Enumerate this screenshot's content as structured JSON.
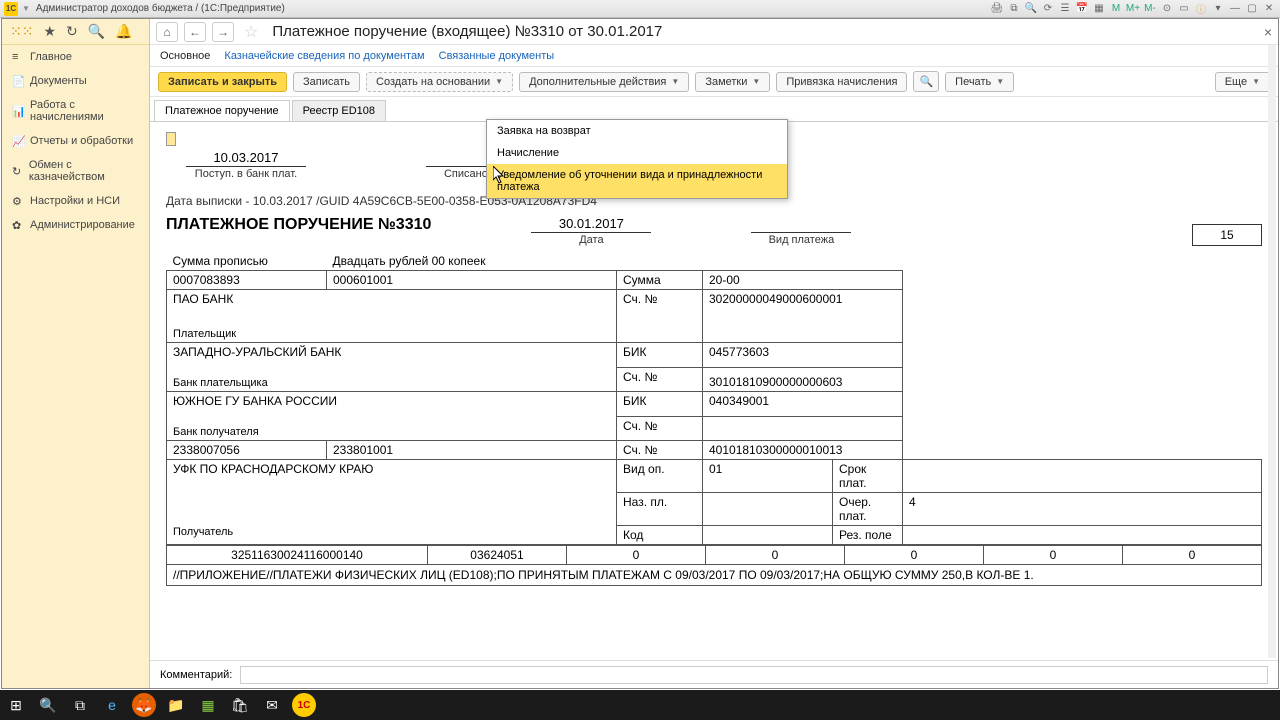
{
  "titlebar": {
    "app": "1C",
    "path": "Администратор доходов бюджета /  (1С:Предприятие)"
  },
  "sidebar": {
    "items": [
      {
        "icon": "≡",
        "label": "Главное"
      },
      {
        "icon": "📄",
        "label": "Документы"
      },
      {
        "icon": "📊",
        "label": "Работа с начислениями"
      },
      {
        "icon": "📈",
        "label": "Отчеты и обработки"
      },
      {
        "icon": "↻",
        "label": "Обмен с казначейством"
      },
      {
        "icon": "⚙",
        "label": "Настройки и НСИ"
      },
      {
        "icon": "✿",
        "label": "Администрирование"
      }
    ]
  },
  "nav": {
    "title": "Платежное поручение (входящее) №3310 от 30.01.2017"
  },
  "linktabs": {
    "t0": "Основное",
    "t1": "Казначейские сведения по документам",
    "t2": "Связанные документы"
  },
  "buttons": {
    "save_close": "Записать и закрыть",
    "save": "Записать",
    "create_based": "Создать на основании",
    "add_actions": "Дополнительные действия",
    "notes": "Заметки",
    "bind": "Привязка начисления",
    "print": "Печать",
    "more": "Еще"
  },
  "tabs": {
    "t0": "Платежное поручение",
    "t1": "Реестр ED108"
  },
  "dropdown": {
    "i0": "Заявка на возврат",
    "i1": "Начисление",
    "i2": "Уведомление об уточнении вида и принадлежности платежа"
  },
  "top_fields": {
    "date1": "10.03.2017",
    "date1_label": "Поступ. в банк плат.",
    "date2_label": "Списано со сч. плат."
  },
  "guid": "Дата выписки - 10.03.2017 /GUID 4A59C6CB-5E00-0358-E053-0A1208A73FD4",
  "header2": {
    "title": "ПЛАТЕЖНОЕ ПОРУЧЕНИЕ №3310",
    "date": "30.01.2017",
    "date_label": "Дата",
    "paytype_label": "Вид платежа",
    "num_box": "15"
  },
  "labels": {
    "sum_words": "Сумма прописью",
    "sum_words_val": "Двадцать рублей 00 копеек",
    "sum": "Сумма",
    "sum_val": "20-00",
    "inn1": "0007083893",
    "kpp1": "000601001",
    "payer_name": "ПАО БАНК",
    "acc_no": "Сч. №",
    "acc1": "30200000049000600001",
    "payer_label": "Плательщик",
    "payer_bank": "ЗАПАДНО-УРАЛЬСКИЙ БАНК",
    "bik": "БИК",
    "bik1": "045773603",
    "acc2": "30101810900000000603",
    "payer_bank_label": "Банк плательщика",
    "recv_bank": "ЮЖНОЕ ГУ БАНКА РОССИИ",
    "bik2": "040349001",
    "recv_bank_label": "Банк получателя",
    "inn2": "2338007056",
    "kpp2": "233801001",
    "acc3": "40101810300000010013",
    "receiver": "УФК ПО КРАСНОДАРСКОМУ КРАЮ",
    "receiver_label": "Получатель",
    "vid_op": "Вид оп.",
    "vid_op_val": "01",
    "srok": "Срок плат.",
    "naz_pl": "Наз. пл.",
    "ocher": "Очер. плат.",
    "ocher_val": "4",
    "kod": "Код",
    "rez": "Рез. поле"
  },
  "codes": {
    "c0": "32511630024116000140",
    "c1": "03624051",
    "c2": "0",
    "c3": "0",
    "c4": "0",
    "c5": "0",
    "c6": "0"
  },
  "purpose": "//ПРИЛОЖЕНИЕ//ПЛАТЕЖИ ФИЗИЧЕСКИХ ЛИЦ (ED108);ПО ПРИНЯТЫМ ПЛАТЕЖАМ С 09/03/2017 ПО 09/03/2017;НА ОБЩУЮ СУММУ 250,В КОЛ-ВЕ 1.",
  "comment_label": "Комментарий:"
}
